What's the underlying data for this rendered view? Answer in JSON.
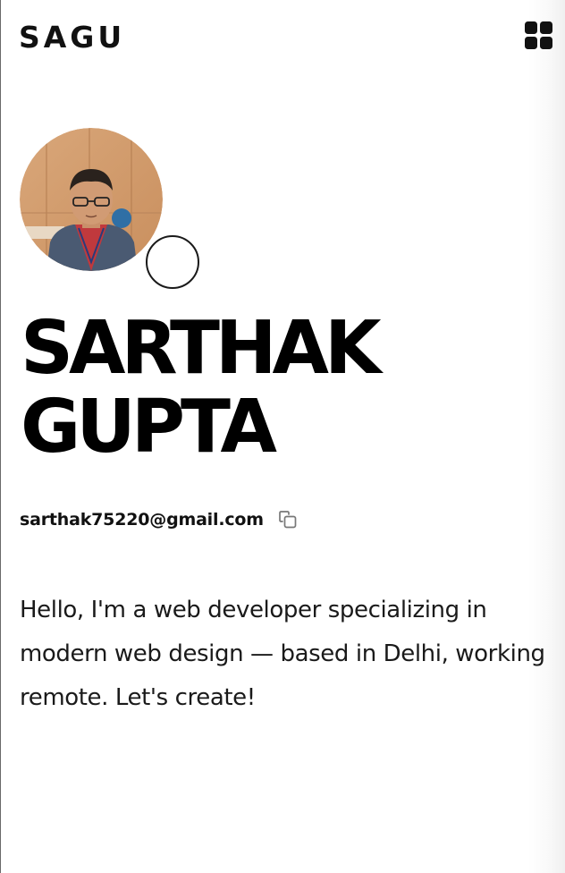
{
  "header": {
    "brand": "SAGU",
    "menu_icon": "grid-menu-icon"
  },
  "profile": {
    "avatar_alt": "profile-photo",
    "name_line1": "SARTHAK",
    "name_line2": "GUPTA",
    "email": "sarthak75220@gmail.com",
    "copy_icon": "copy-icon",
    "bio": "Hello, I'm a web developer specializing in modern web design — based in Delhi, working remote. Let's create!"
  }
}
